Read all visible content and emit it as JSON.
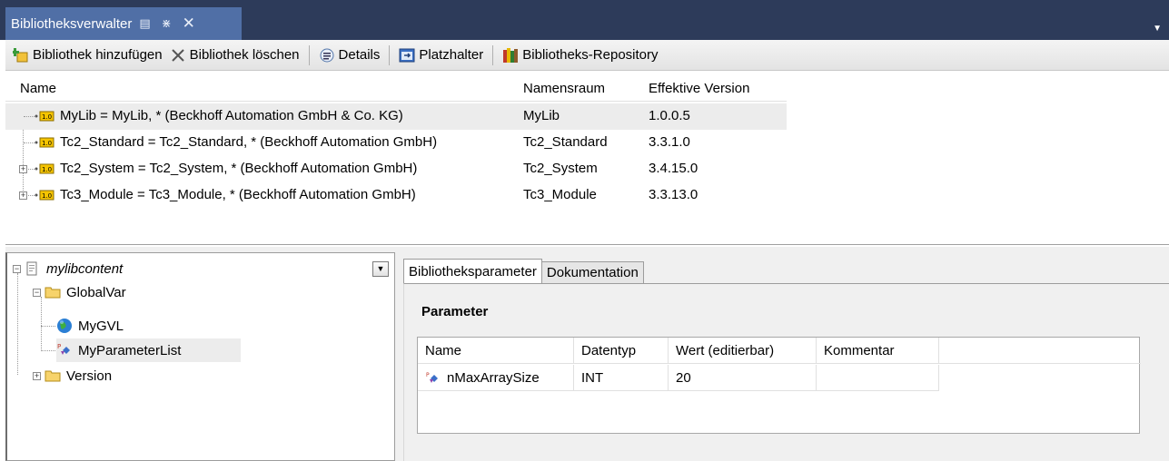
{
  "window": {
    "tab_title": "Bibliotheksverwalter",
    "icons": [
      "pin-icon",
      "dock-icon",
      "close-icon",
      "dropdown-icon"
    ]
  },
  "toolbar": {
    "add_label": "Bibliothek hinzufügen",
    "delete_label": "Bibliothek löschen",
    "details_label": "Details",
    "placeholder_label": "Platzhalter",
    "repository_label": "Bibliotheks-Repository"
  },
  "libraries": {
    "columns": [
      "Name",
      "Namensraum",
      "Effektive Version"
    ],
    "rows": [
      {
        "name": "MyLib = MyLib, * (Beckhoff Automation GmbH & Co. KG)",
        "namespace": "MyLib",
        "version": "1.0.0.5"
      },
      {
        "name": "Tc2_Standard = Tc2_Standard, * (Beckhoff Automation GmbH)",
        "namespace": "Tc2_Standard",
        "version": "3.3.1.0"
      },
      {
        "name": "Tc2_System = Tc2_System, * (Beckhoff Automation GmbH)",
        "namespace": "Tc2_System",
        "version": "3.4.15.0"
      },
      {
        "name": "Tc3_Module = Tc3_Module, * (Beckhoff Automation GmbH)",
        "namespace": "Tc3_Module",
        "version": "3.3.13.0"
      }
    ],
    "icon_badge": "1.0"
  },
  "content_tree": {
    "root": "mylibcontent",
    "items": [
      {
        "label": "GlobalVar"
      },
      {
        "label": "MyGVL"
      },
      {
        "label": "MyParameterList"
      },
      {
        "label": "Version"
      }
    ]
  },
  "tabs": [
    "Bibliotheksparameter",
    "Dokumentation"
  ],
  "parameters": {
    "title": "Parameter",
    "columns": [
      "Name",
      "Datentyp",
      "Wert (editierbar)",
      "Kommentar"
    ],
    "rows": [
      {
        "name": "nMaxArraySize",
        "type": "INT",
        "value": "20",
        "comment": ""
      }
    ]
  },
  "colors": {
    "titlebar": "#2d3b5a",
    "active_tab": "#506fa6",
    "selection": "#ececec"
  }
}
